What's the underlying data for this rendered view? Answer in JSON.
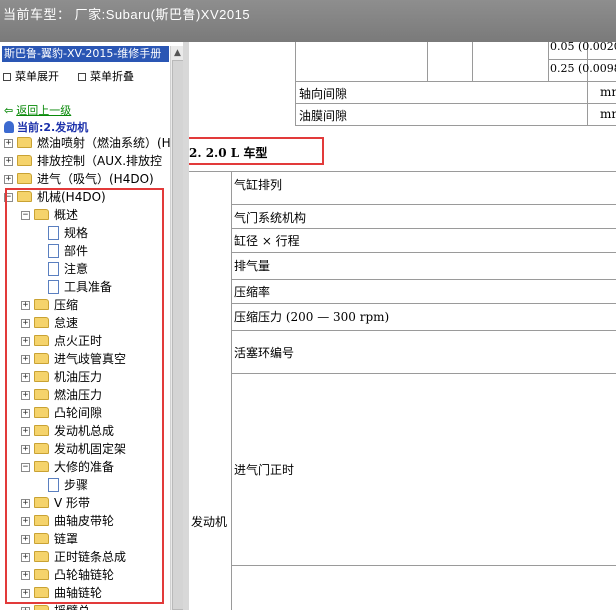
{
  "window": {
    "title": "当前车型：  厂家:Subaru(斯巴鲁)XV2015"
  },
  "sidebar": {
    "manual_title": "斯巴鲁-翼豹-XV-2015-维修手册",
    "expand_label": "菜单展开",
    "collapse_label": "菜单折叠",
    "back_label": "返回上一级",
    "current_label": "当前:2.发动机",
    "tree": [
      {
        "label": "燃油喷射（燃油系统）(H",
        "type": "folder",
        "level": 0,
        "expanded": false
      },
      {
        "label": "排放控制（AUX.排放控",
        "type": "folder",
        "level": 0,
        "expanded": false
      },
      {
        "label": "进气（吸气）(H4DO)",
        "type": "folder",
        "level": 0,
        "expanded": false
      },
      {
        "label": "机械(H4DO)",
        "type": "folder",
        "level": 0,
        "expanded": true
      },
      {
        "label": "概述",
        "type": "folder",
        "level": 1,
        "expanded": true
      },
      {
        "label": "规格",
        "type": "doc",
        "level": 2
      },
      {
        "label": "部件",
        "type": "doc",
        "level": 2
      },
      {
        "label": "注意",
        "type": "doc",
        "level": 2
      },
      {
        "label": "工具准备",
        "type": "doc",
        "level": 2
      },
      {
        "label": "压缩",
        "type": "folder",
        "level": 1,
        "expanded": false
      },
      {
        "label": "怠速",
        "type": "folder",
        "level": 1,
        "expanded": false
      },
      {
        "label": "点火正时",
        "type": "folder",
        "level": 1,
        "expanded": false
      },
      {
        "label": "进气歧管真空",
        "type": "folder",
        "level": 1,
        "expanded": false
      },
      {
        "label": "机油压力",
        "type": "folder",
        "level": 1,
        "expanded": false
      },
      {
        "label": "燃油压力",
        "type": "folder",
        "level": 1,
        "expanded": false
      },
      {
        "label": "凸轮间隙",
        "type": "folder",
        "level": 1,
        "expanded": false
      },
      {
        "label": "发动机总成",
        "type": "folder",
        "level": 1,
        "expanded": false
      },
      {
        "label": "发动机固定架",
        "type": "folder",
        "level": 1,
        "expanded": false
      },
      {
        "label": "大修的准备",
        "type": "folder",
        "level": 1,
        "expanded": true
      },
      {
        "label": "步骤",
        "type": "doc",
        "level": 2
      },
      {
        "label": "V 形带",
        "type": "folder",
        "level": 1,
        "expanded": false
      },
      {
        "label": "曲轴皮带轮",
        "type": "folder",
        "level": 1,
        "expanded": false
      },
      {
        "label": "链罩",
        "type": "folder",
        "level": 1,
        "expanded": false
      },
      {
        "label": "正时链条总成",
        "type": "folder",
        "level": 1,
        "expanded": false
      },
      {
        "label": "凸轮轴链轮",
        "type": "folder",
        "level": 1,
        "expanded": false
      },
      {
        "label": "曲轴链轮",
        "type": "folder",
        "level": 1,
        "expanded": false
      },
      {
        "label": "摇臂总",
        "type": "folder",
        "level": 1,
        "expanded": false
      }
    ]
  },
  "content": {
    "top_values": [
      "0.05 (0.0020",
      "0.25 (0.0098"
    ],
    "axial_clearance": "轴向间隙",
    "oil_film_clearance": "油膜间隙",
    "unit_partial": "mr",
    "section_title": "2. 2.0 L 车型",
    "group_label": "发动机",
    "rows": [
      "气缸排列",
      "气门系统机构",
      "缸径 × 行程",
      "排气量",
      "压缩率",
      "压缩压力 (200 — 300 rpm)",
      "活塞环编号",
      "进气门正时"
    ]
  }
}
